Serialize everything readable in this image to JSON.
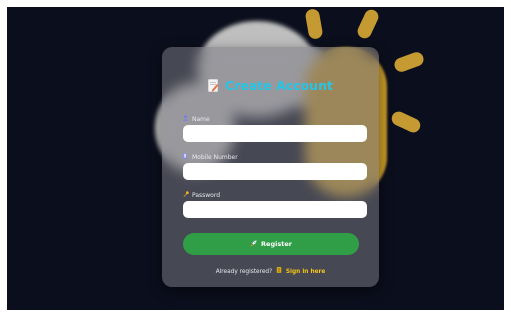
{
  "form": {
    "title": "Create Account",
    "title_icon": "document-edit-icon",
    "accent_color": "#24c6e8",
    "fields": [
      {
        "label": "Name",
        "icon": "user-icon",
        "value": "",
        "placeholder": ""
      },
      {
        "label": "Mobile Number",
        "icon": "phone-icon",
        "value": "",
        "placeholder": ""
      },
      {
        "label": "Password",
        "icon": "key-icon",
        "value": "",
        "placeholder": ""
      }
    ],
    "submit_label": "Register",
    "submit_icon": "rocket-icon",
    "submit_color": "#2f9e47",
    "footer_text": "Already registered?",
    "footer_link_icon": "door-icon",
    "footer_link_label": "Sign in here",
    "link_color": "#f5c518"
  },
  "background": {
    "color": "#0b0e1c",
    "decoration": [
      "cloud",
      "sun"
    ]
  }
}
